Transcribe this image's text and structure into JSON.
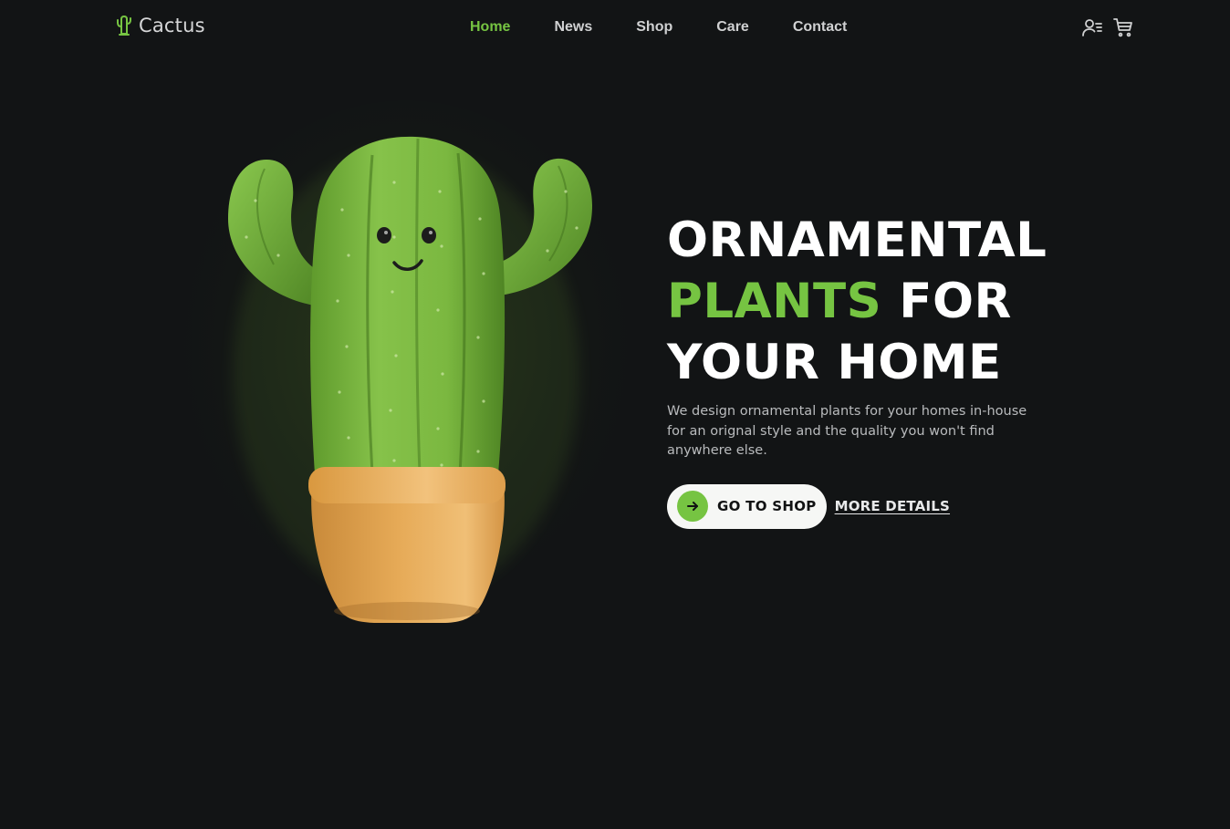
{
  "brand": {
    "name": "Cactus",
    "icon": "cactus-icon"
  },
  "nav": {
    "items": [
      {
        "label": "Home",
        "active": true
      },
      {
        "label": "News",
        "active": false
      },
      {
        "label": "Shop",
        "active": false
      },
      {
        "label": "Care",
        "active": false
      },
      {
        "label": "Contact",
        "active": false
      }
    ]
  },
  "header_actions": {
    "account_icon": "user-menu-icon",
    "cart_icon": "cart-icon"
  },
  "hero": {
    "title_line1": "ORNAMENTAL",
    "title_line2_accent": "PLANTS",
    "title_line2_rest": "FOR",
    "title_line3": "YOUR HOME",
    "description": "We design ornamental plants for your homes in-house for an orignal style and the quality you won't find anywhere else.",
    "primary_cta": "GO TO SHOP",
    "secondary_cta": "MORE DETAILS",
    "illustration": "cactus-in-pot-illustration"
  },
  "colors": {
    "background": "#121415",
    "accent": "#76c442",
    "text": "#ffffff",
    "muted_text": "#b9bbbd",
    "pot": "#e0a351"
  }
}
